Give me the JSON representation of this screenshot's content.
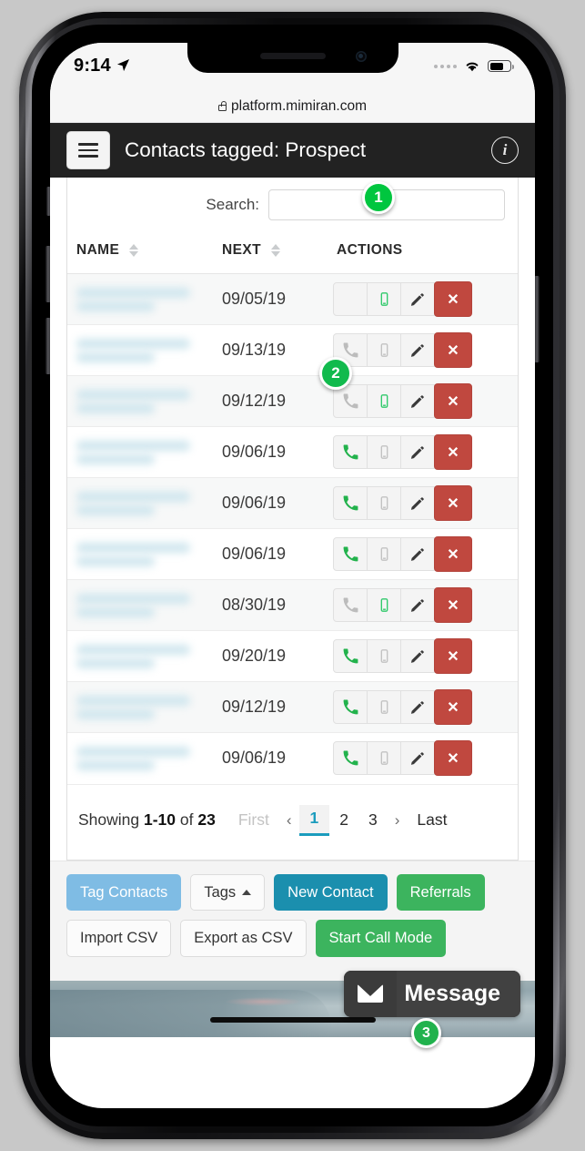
{
  "status_bar": {
    "time": "9:14",
    "location_icon": "location-arrow-icon",
    "signal_icon": "signal-dots-icon",
    "wifi_icon": "wifi-icon",
    "battery_icon": "battery-icon"
  },
  "browser": {
    "lock_icon": "lock-icon",
    "url": "platform.mimiran.com"
  },
  "app_bar": {
    "menu_icon": "hamburger-menu-icon",
    "title": "Contacts tagged: Prospect",
    "info_icon": "info-circle-icon"
  },
  "badges": [
    {
      "id": "1",
      "label": "1",
      "color": "#00c63f"
    },
    {
      "id": "2",
      "label": "2",
      "color": "#11ba4d"
    },
    {
      "id": "3",
      "label": "3",
      "color": "#21b24d"
    }
  ],
  "search": {
    "label": "Search:",
    "value": "",
    "placeholder": ""
  },
  "table": {
    "columns": [
      "NAME",
      "NEXT",
      "ACTIONS"
    ],
    "sort_icon": "sort-updown-icon",
    "action_icons": {
      "call": "phone-handset-icon",
      "text": "mobile-phone-icon",
      "edit": "pencil-icon",
      "delete": "close-x-icon"
    },
    "rows": [
      {
        "name": "",
        "next": "09/05/19",
        "call_active": true,
        "text_active": true,
        "call_hidden_by_badge": true
      },
      {
        "name": "",
        "next": "09/13/19",
        "call_active": false,
        "text_active": false,
        "call_hidden_by_badge": false
      },
      {
        "name": "",
        "next": "09/12/19",
        "call_active": false,
        "text_active": true,
        "call_hidden_by_badge": false
      },
      {
        "name": "",
        "next": "09/06/19",
        "call_active": true,
        "text_active": false,
        "call_hidden_by_badge": false
      },
      {
        "name": "",
        "next": "09/06/19",
        "call_active": true,
        "text_active": false,
        "call_hidden_by_badge": false
      },
      {
        "name": "",
        "next": "09/06/19",
        "call_active": true,
        "text_active": false,
        "call_hidden_by_badge": false
      },
      {
        "name": "",
        "next": "08/30/19",
        "call_active": false,
        "text_active": true,
        "call_hidden_by_badge": false
      },
      {
        "name": "",
        "next": "09/20/19",
        "call_active": true,
        "text_active": false,
        "call_hidden_by_badge": false
      },
      {
        "name": "",
        "next": "09/12/19",
        "call_active": true,
        "text_active": false,
        "call_hidden_by_badge": false
      },
      {
        "name": "",
        "next": "09/06/19",
        "call_active": true,
        "text_active": false,
        "call_hidden_by_badge": false
      }
    ]
  },
  "pagination": {
    "showing_prefix": "Showing ",
    "range": "1-10",
    "of_text": " of ",
    "total": "23",
    "first": "First",
    "prev": "‹",
    "pages": [
      "1",
      "2",
      "3"
    ],
    "active_page": "1",
    "next": "›",
    "last": "Last",
    "accent": "#1b9cbd"
  },
  "toolbar": {
    "row1": [
      {
        "label": "Tag Contacts",
        "style": "light-blue"
      },
      {
        "label": "Tags",
        "style": "white",
        "caret": "caret-up-icon"
      },
      {
        "label": "New Contact",
        "style": "teal"
      },
      {
        "label": "Referrals",
        "style": "green"
      }
    ],
    "row2": [
      {
        "label": "Import CSV",
        "style": "white"
      },
      {
        "label": "Export as CSV",
        "style": "white"
      },
      {
        "label": "Start Call Mode",
        "style": "green"
      }
    ]
  },
  "message_fab": {
    "icon": "envelope-icon",
    "label": "Message"
  }
}
